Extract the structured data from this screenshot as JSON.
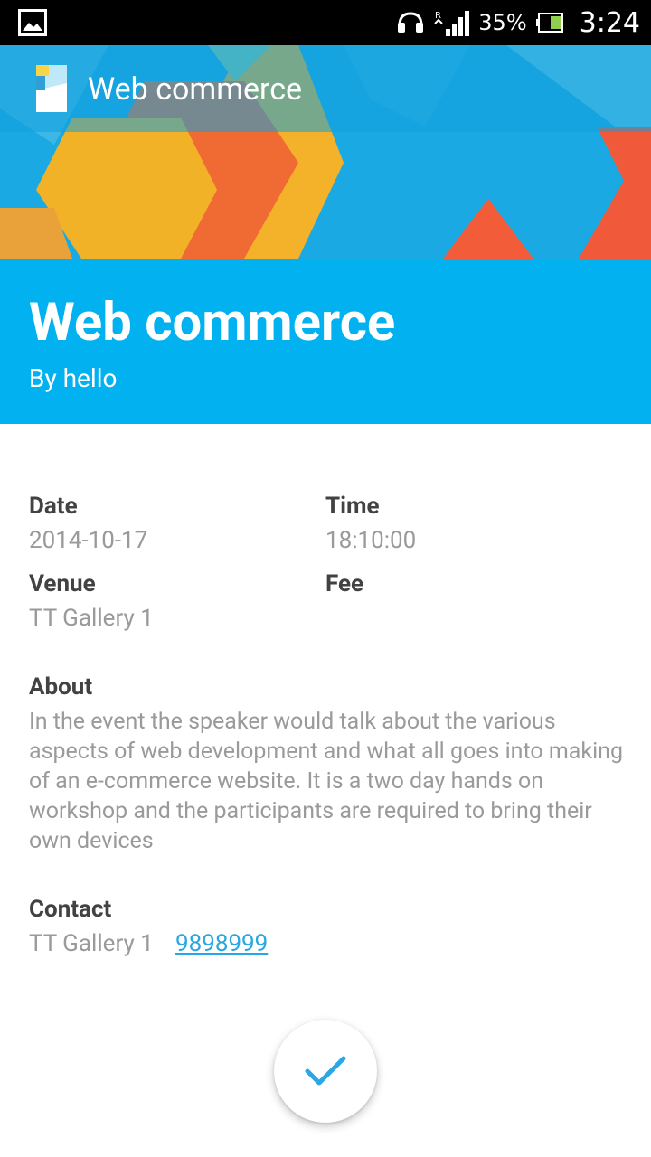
{
  "status_bar": {
    "battery_percent": "35%",
    "time": "3:24",
    "icons": [
      "gallery-icon",
      "headset-icon",
      "signal-icon",
      "battery-icon"
    ]
  },
  "toolbar": {
    "title": "Web commerce",
    "logo_icon": "app-logo-icon"
  },
  "event": {
    "title": "Web commerce",
    "author": "By hello"
  },
  "details": {
    "date_label": "Date",
    "date_value": "2014-10-17",
    "time_label": "Time",
    "time_value": "18:10:00",
    "venue_label": "Venue",
    "venue_value": "TT Gallery 1",
    "fee_label": "Fee",
    "fee_value": ""
  },
  "about": {
    "label": "About",
    "text": "In the event the speaker would talk about the various aspects of web development and what all goes into making of an e-commerce website. It is a two day hands on workshop and the participants are required to bring their own devices"
  },
  "contact": {
    "label": "Contact",
    "name": "TT Gallery 1",
    "phone": "9898999"
  },
  "fab": {
    "icon": "check-icon"
  },
  "colors": {
    "accent": "#02b1f0",
    "link": "#27a7e3",
    "label": "#424242",
    "value": "#9a9a9a"
  }
}
